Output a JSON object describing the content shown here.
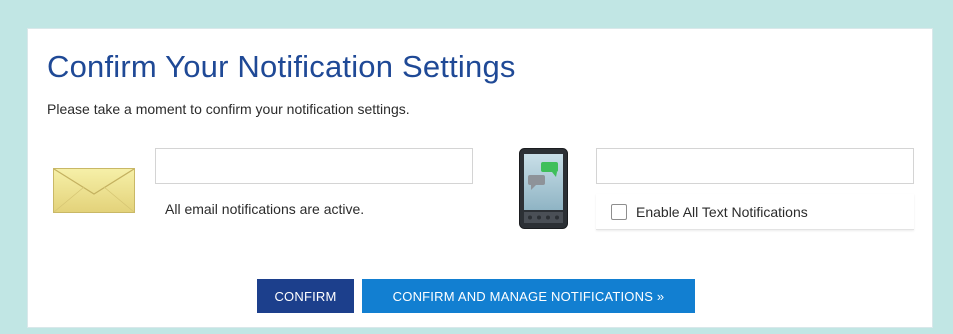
{
  "header": {
    "title": "Confirm Your Notification Settings",
    "subtitle": "Please take a moment to confirm your notification settings."
  },
  "email": {
    "input_value": "",
    "status_text": "All email notifications are active.",
    "icon": "envelope-icon"
  },
  "text_messages": {
    "input_value": "",
    "checkbox_label": "Enable All Text Notifications",
    "checkbox_checked": false,
    "icon": "mobile-phone-icon"
  },
  "actions": {
    "confirm_label": "CONFIRM",
    "confirm_manage_label": "CONFIRM AND MANAGE NOTIFICATIONS »"
  },
  "colors": {
    "page_background": "#c1e6e4",
    "title": "#1f4996",
    "confirm_button": "#1c3f8c",
    "confirm_manage_button": "#127fd1"
  }
}
